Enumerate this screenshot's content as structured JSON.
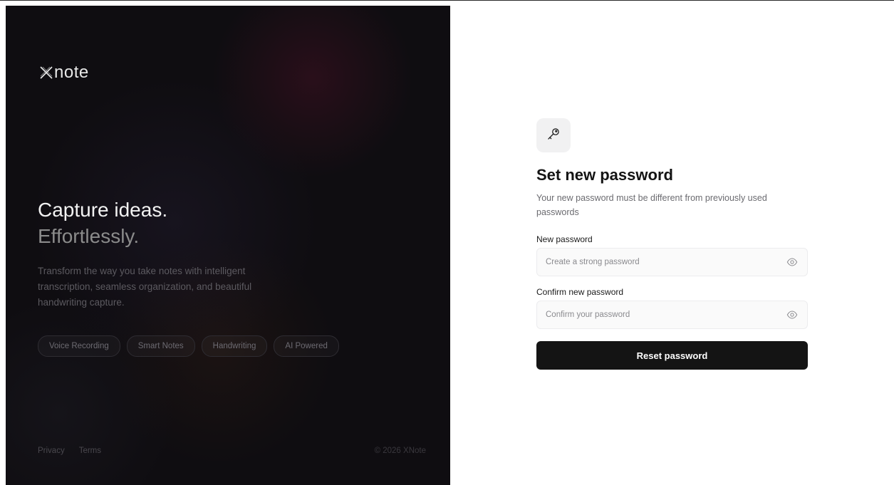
{
  "brand": {
    "name": "note",
    "logo_icon": "x-logo-icon"
  },
  "hero": {
    "headline": "Capture ideas.",
    "subheadline": "Effortlessly.",
    "description": "Transform the way you take notes with intelligent transcription, seamless organization, and beautiful handwriting capture.",
    "chips": [
      "Voice Recording",
      "Smart Notes",
      "Handwriting",
      "AI Powered"
    ]
  },
  "footer": {
    "links": [
      "Privacy",
      "Terms"
    ],
    "copyright": "© 2026 XNote"
  },
  "form": {
    "icon": "key-icon",
    "title": "Set new password",
    "subtitle": "Your new password must be different from previously used passwords",
    "new_password": {
      "label": "New password",
      "placeholder": "Create a strong password",
      "value": "",
      "toggle_icon": "eye-icon"
    },
    "confirm_password": {
      "label": "Confirm new password",
      "placeholder": "Confirm your password",
      "value": "",
      "toggle_icon": "eye-icon"
    },
    "submit_label": "Reset password"
  },
  "colors": {
    "hero_background": "#0f0d11",
    "primary_button": "#141414",
    "input_background": "#fafafa"
  }
}
